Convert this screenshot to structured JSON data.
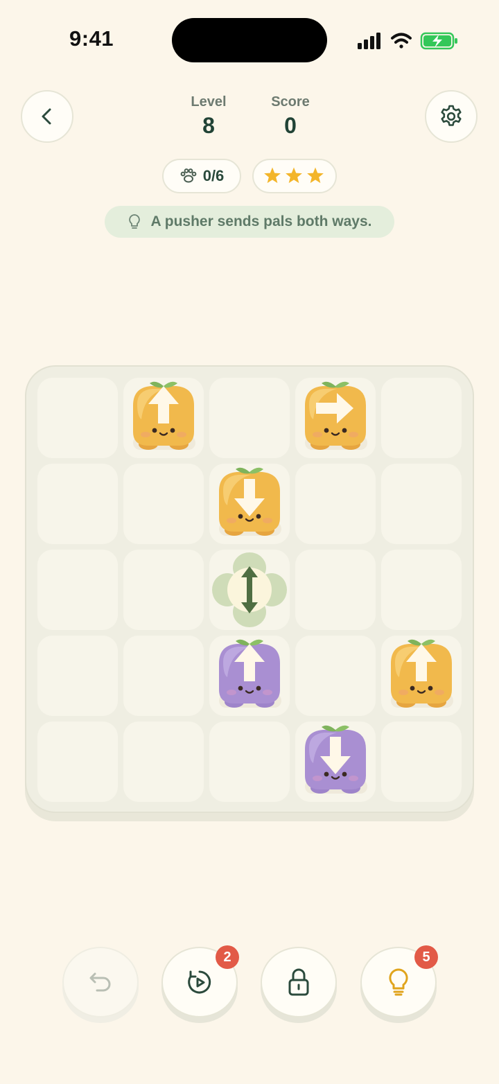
{
  "status_bar": {
    "time": "9:41"
  },
  "header": {
    "level_label": "Level",
    "level_value": "8",
    "score_label": "Score",
    "score_value": "0",
    "pals_counter": "0/6",
    "stars_earned": 3,
    "hint_text": "A pusher sends pals both ways."
  },
  "board": {
    "rows": 5,
    "cols": 5,
    "pieces": [
      {
        "row": 0,
        "col": 1,
        "type": "pal",
        "color": "orange",
        "arrow": "up"
      },
      {
        "row": 0,
        "col": 3,
        "type": "pal",
        "color": "orange",
        "arrow": "right"
      },
      {
        "row": 1,
        "col": 2,
        "type": "pal",
        "color": "orange",
        "arrow": "down"
      },
      {
        "row": 2,
        "col": 2,
        "type": "pusher",
        "arrow": "up-down"
      },
      {
        "row": 3,
        "col": 2,
        "type": "pal",
        "color": "purple",
        "arrow": "up"
      },
      {
        "row": 3,
        "col": 4,
        "type": "pal",
        "color": "orange",
        "arrow": "up"
      },
      {
        "row": 4,
        "col": 3,
        "type": "pal",
        "color": "purple",
        "arrow": "down"
      }
    ]
  },
  "toolbar": {
    "rewind_count": "2",
    "hint_count": "5"
  },
  "colors": {
    "background": "#fcf6ea",
    "orange_pal": "#f1b94c",
    "purple_pal": "#a98fd2",
    "badge": "#e25a47",
    "star": "#f3b52a"
  }
}
